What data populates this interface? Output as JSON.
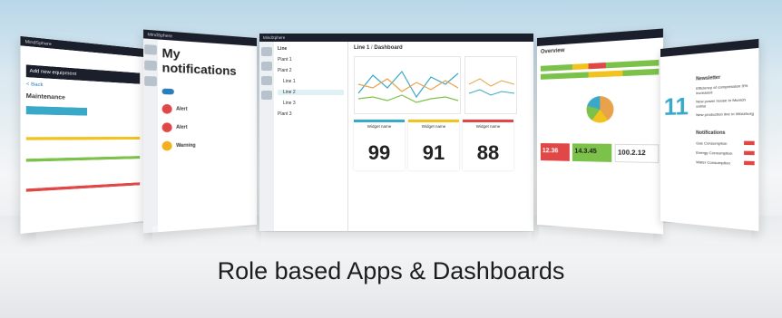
{
  "caption": "Role based Apps & Dashboards",
  "screens": {
    "left": {
      "app_name": "MindSphere",
      "button_label": "Add new equipment",
      "section": "Maintenance",
      "back": "< Back"
    },
    "notifications": {
      "app_name": "MindSphere",
      "title": "My notifications",
      "items": [
        {
          "type": "Alert",
          "color": "#e04848"
        },
        {
          "type": "Alert",
          "color": "#e04848"
        },
        {
          "type": "Warning",
          "color": "#f2b01e"
        }
      ]
    },
    "dashboard": {
      "app_name": "MindSphere",
      "line_label": "Line 1",
      "breadcrumb": "Dashboard",
      "tree": [
        "Line",
        "Plant 1",
        "Plant 2",
        "Line 1",
        "Line 2",
        "Line 3",
        "Plant 3"
      ],
      "widgets": [
        {
          "title": "Widget name",
          "value": "99",
          "accent": "#3aa9c9"
        },
        {
          "title": "Widget name",
          "value": "91",
          "accent": "#f2c21e"
        },
        {
          "title": "Widget name",
          "value": "88",
          "accent": "#e04848"
        }
      ]
    },
    "overview": {
      "title": "Overview",
      "kpis": [
        {
          "value": "12.36",
          "color": "#e04848"
        },
        {
          "value": "14.3.45",
          "color": "#7cc24a"
        },
        {
          "value": "100.2.12",
          "color": "#ffffff"
        }
      ]
    },
    "right": {
      "big_number": "11",
      "newsletter": "Newsletter",
      "notifications": "Notifications",
      "news_items": [
        "Efficiency of compression 5% increased",
        "New power house in Munich online",
        "New production line in Würzburg"
      ],
      "notif_items": [
        "Gas Consumption",
        "Energy Consumption",
        "Water Consumption"
      ]
    }
  },
  "colors": {
    "accent_blue": "#3aa9c9",
    "alert_red": "#e04848",
    "warning_yellow": "#f2c21e",
    "ok_green": "#7cc24a"
  }
}
